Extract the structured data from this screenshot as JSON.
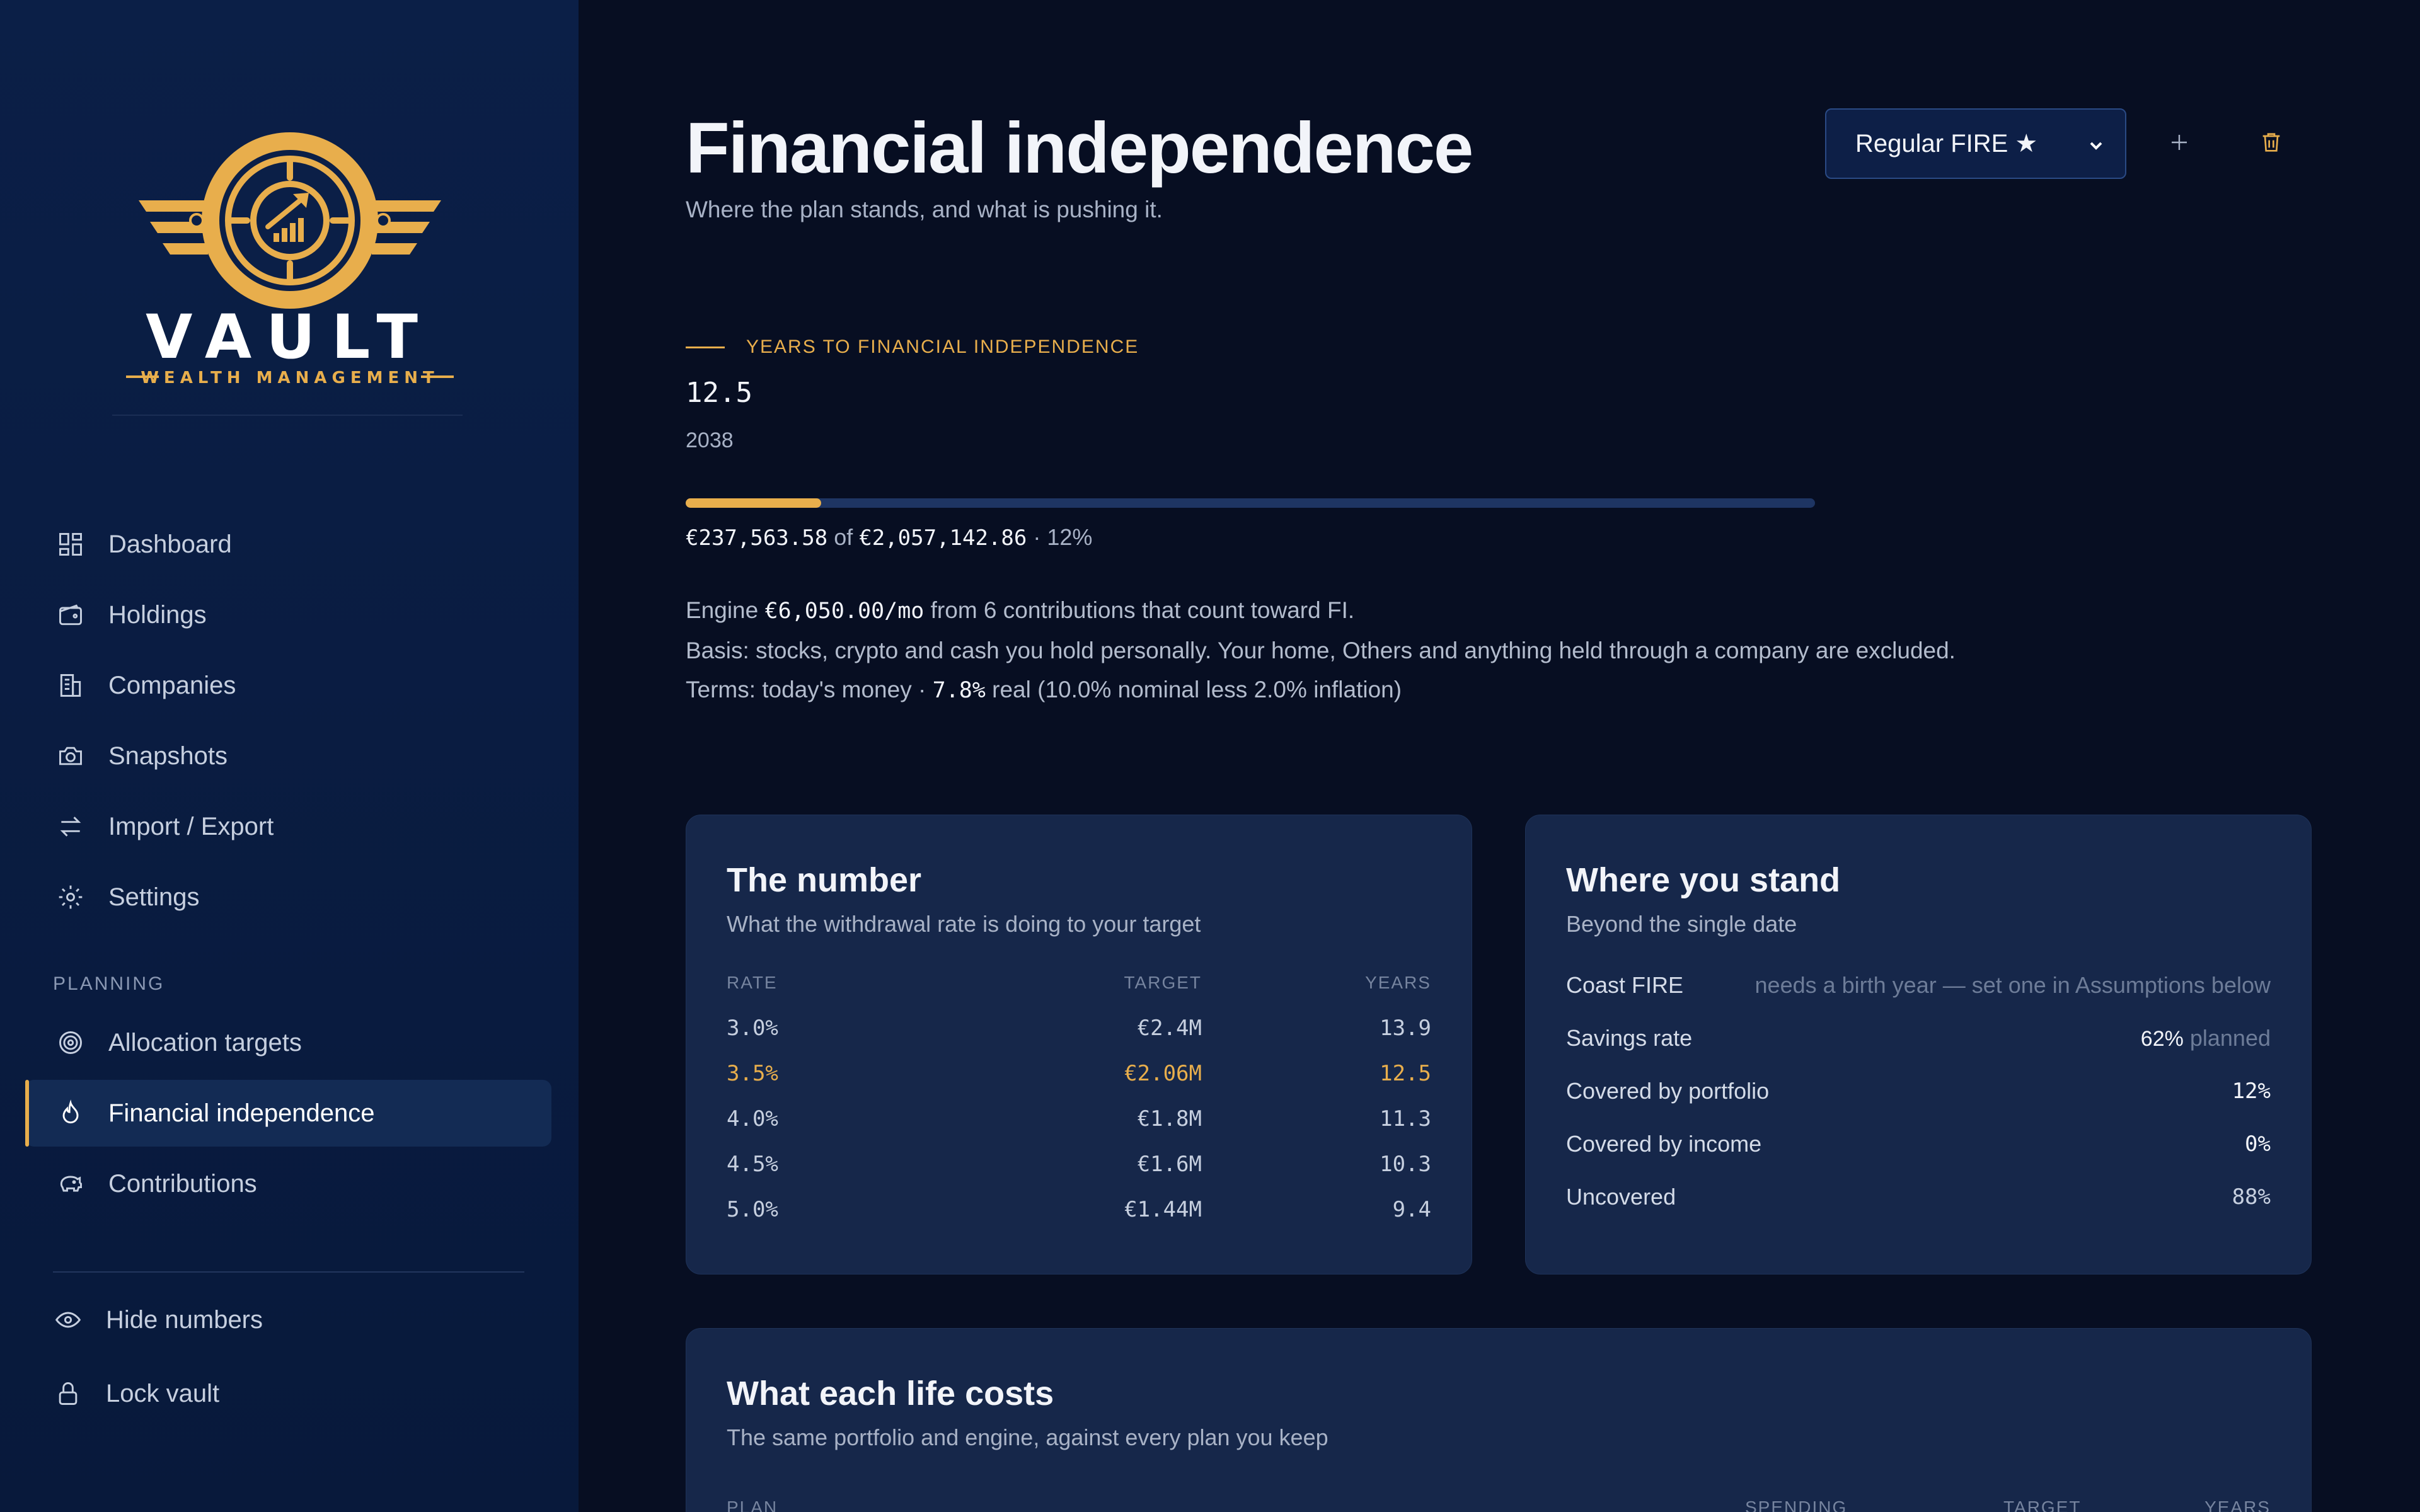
{
  "brand": {
    "name": "VAULT",
    "tagline": "WEALTH MANAGEMENT",
    "colors": {
      "gold": "#e8ae4c",
      "navy": "#0b1f47",
      "background": "#070e22"
    }
  },
  "sidebar": {
    "nav": [
      {
        "label": "Dashboard",
        "icon": "dashboard-icon"
      },
      {
        "label": "Holdings",
        "icon": "wallet-icon"
      },
      {
        "label": "Companies",
        "icon": "building-icon"
      },
      {
        "label": "Snapshots",
        "icon": "camera-icon"
      },
      {
        "label": "Import / Export",
        "icon": "arrows-swap-icon"
      },
      {
        "label": "Settings",
        "icon": "gear-icon"
      }
    ],
    "section_label": "PLANNING",
    "planning": [
      {
        "label": "Allocation targets",
        "icon": "target-icon"
      },
      {
        "label": "Financial independence",
        "icon": "flame-icon",
        "active": true
      },
      {
        "label": "Contributions",
        "icon": "piggy-bank-icon"
      }
    ],
    "footer": [
      {
        "label": "Hide numbers",
        "icon": "eye-icon"
      },
      {
        "label": "Lock vault",
        "icon": "lock-icon"
      }
    ]
  },
  "header": {
    "title": "Financial independence",
    "subtitle": "Where the plan stands, and what is pushing it.",
    "plan_select": "Regular FIRE ★"
  },
  "summary": {
    "kicker": "YEARS TO FINANCIAL INDEPENDENCE",
    "years": "12.5",
    "target_year": "2038",
    "progress_fraction": 0.12,
    "current": "€237,563.58",
    "of": "of",
    "target": "€2,057,142.86",
    "percent": "· 12%",
    "engine_prefix": "Engine",
    "engine_amount": "€6,050.00/mo",
    "engine_suffix": "from 6 contributions that count toward FI.",
    "basis": "Basis: stocks, crypto and cash you hold personally. Your home, Others and anything held through a company are excluded.",
    "terms_prefix": "Terms: today's money ·",
    "terms_rate": "7.8%",
    "terms_suffix": "real (10.0% nominal less 2.0% inflation)"
  },
  "number_card": {
    "title": "The number",
    "subtitle": "What the withdrawal rate is doing to your target",
    "headers": [
      "RATE",
      "TARGET",
      "YEARS"
    ],
    "rows": [
      {
        "rate": "3.0%",
        "target": "€2.4M",
        "years": "13.9"
      },
      {
        "rate": "3.5%",
        "target": "€2.06M",
        "years": "12.5",
        "highlight": true
      },
      {
        "rate": "4.0%",
        "target": "€1.8M",
        "years": "11.3"
      },
      {
        "rate": "4.5%",
        "target": "€1.6M",
        "years": "10.3"
      },
      {
        "rate": "5.0%",
        "target": "€1.44M",
        "years": "9.4"
      }
    ]
  },
  "stand_card": {
    "title": "Where you stand",
    "subtitle": "Beyond the single date",
    "coast_label": "Coast FIRE",
    "coast_value": "needs a birth year — set one in Assumptions below",
    "savings_label": "Savings rate",
    "savings_value": "62%",
    "savings_note": "planned",
    "portfolio_label": "Covered by portfolio",
    "portfolio_value": "12%",
    "income_label": "Covered by income",
    "income_value": "0%",
    "uncovered_label": "Uncovered",
    "uncovered_value": "88%"
  },
  "lifecost_card": {
    "title": "What each life costs",
    "subtitle": "The same portfolio and engine, against every plan you keep",
    "headers": [
      "PLAN",
      "SPENDING",
      "TARGET",
      "YEARS"
    ]
  }
}
